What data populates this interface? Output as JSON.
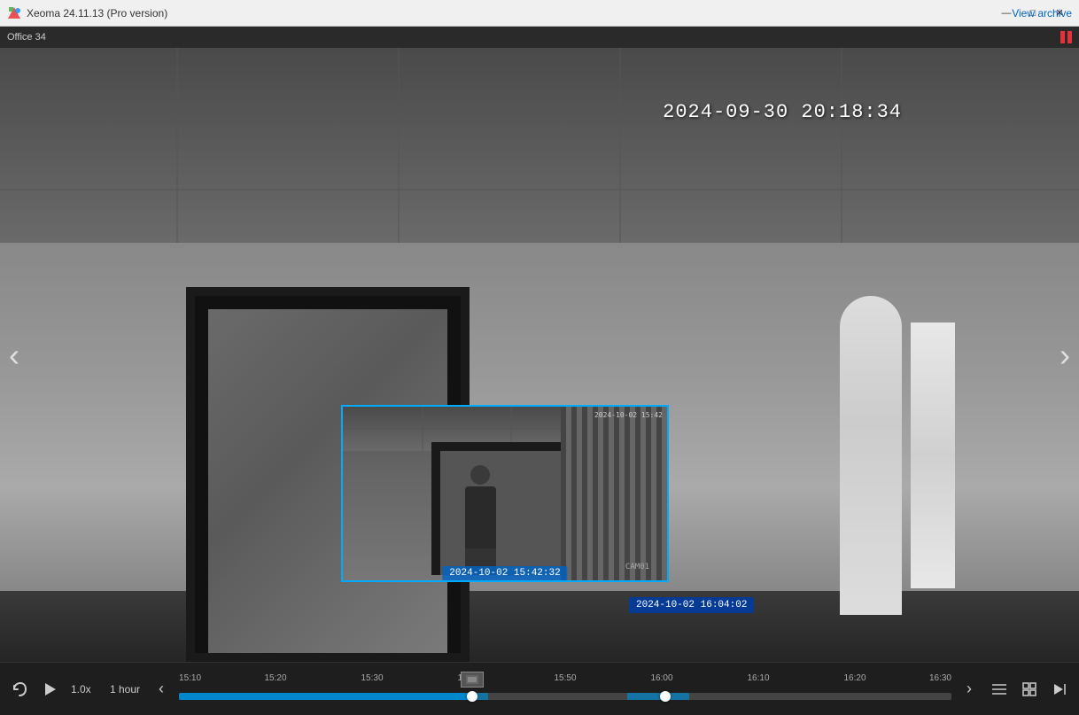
{
  "titlebar": {
    "title": "Xeoma 24.11.13 (Pro version)",
    "menu": "View archive",
    "logo_color": "#e84040"
  },
  "camera": {
    "label": "Office 34",
    "timestamp": "2024-09-30 20:18:34"
  },
  "preview": {
    "timestamp": "2024-10-02 15:42:32",
    "small_label": "CAM01"
  },
  "tooltip": {
    "text": "2024-10-02 16:04:02"
  },
  "controls": {
    "speed": "1.0x",
    "interval": "1 hour",
    "nav_prev_label": "◁",
    "play_label": "▷",
    "nav_left_label": "‹",
    "nav_right_label": "›"
  },
  "timeline": {
    "times": [
      "15:10",
      "15:20",
      "15:30",
      "15:40",
      "15:50",
      "16:00",
      "16:10",
      "16:20",
      "16:30"
    ],
    "thumb_position_pct": 38,
    "thumb2_position_pct": 63
  },
  "window_controls": {
    "minimize": "—",
    "maximize": "□",
    "close": "✕"
  }
}
